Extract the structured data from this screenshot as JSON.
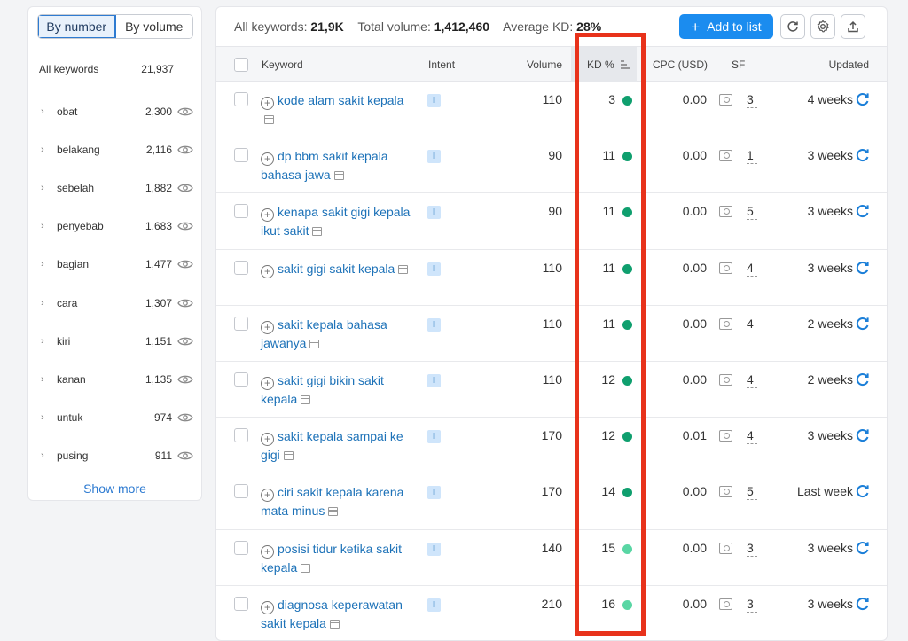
{
  "toggle": {
    "by_number": "By number",
    "by_volume": "By volume"
  },
  "groups_header": {
    "label": "All keywords",
    "count": "21,937"
  },
  "groups": [
    {
      "word": "obat",
      "count": "2,300"
    },
    {
      "word": "belakang",
      "count": "2,116"
    },
    {
      "word": "sebelah",
      "count": "1,882"
    },
    {
      "word": "penyebab",
      "count": "1,683"
    },
    {
      "word": "bagian",
      "count": "1,477"
    },
    {
      "word": "cara",
      "count": "1,307"
    },
    {
      "word": "kiri",
      "count": "1,151"
    },
    {
      "word": "kanan",
      "count": "1,135"
    },
    {
      "word": "untuk",
      "count": "974"
    },
    {
      "word": "pusing",
      "count": "911"
    }
  ],
  "show_more": "Show more",
  "summary": {
    "all_label": "All keywords:",
    "all_value": "21,9K",
    "volume_label": "Total volume:",
    "volume_value": "1,412,460",
    "kd_label": "Average KD:",
    "kd_value": "28%"
  },
  "add_to_list": "Add to list",
  "columns": {
    "keyword": "Keyword",
    "intent": "Intent",
    "volume": "Volume",
    "kd": "KD %",
    "cpc": "CPC (USD)",
    "sf": "SF",
    "updated": "Updated"
  },
  "colors": {
    "kd_dark": "#0f9f6e",
    "kd_light": "#59d6a4",
    "highlight": "#e8321b",
    "accent": "#1b8cef"
  },
  "rows": [
    {
      "keyword": "kode alam sakit kepala",
      "intent": "I",
      "volume": "110",
      "kd": "3",
      "kd_color": "#0f9f6e",
      "cpc": "0.00",
      "sf": "3",
      "updated": "4 weeks"
    },
    {
      "keyword": "dp bbm sakit kepala bahasa jawa",
      "intent": "I",
      "volume": "90",
      "kd": "11",
      "kd_color": "#0f9f6e",
      "cpc": "0.00",
      "sf": "1",
      "updated": "3 weeks"
    },
    {
      "keyword": "kenapa sakit gigi kepala ikut sakit",
      "intent": "I",
      "volume": "90",
      "kd": "11",
      "kd_color": "#0f9f6e",
      "cpc": "0.00",
      "sf": "5",
      "updated": "3 weeks"
    },
    {
      "keyword": "sakit gigi sakit kepala",
      "intent": "I",
      "volume": "110",
      "kd": "11",
      "kd_color": "#0f9f6e",
      "cpc": "0.00",
      "sf": "4",
      "updated": "3 weeks"
    },
    {
      "keyword": "sakit kepala bahasa jawanya",
      "intent": "I",
      "volume": "110",
      "kd": "11",
      "kd_color": "#0f9f6e",
      "cpc": "0.00",
      "sf": "4",
      "updated": "2 weeks"
    },
    {
      "keyword": "sakit gigi bikin sakit kepala",
      "intent": "I",
      "volume": "110",
      "kd": "12",
      "kd_color": "#0f9f6e",
      "cpc": "0.00",
      "sf": "4",
      "updated": "2 weeks"
    },
    {
      "keyword": "sakit kepala sampai ke gigi",
      "intent": "I",
      "volume": "170",
      "kd": "12",
      "kd_color": "#0f9f6e",
      "cpc": "0.01",
      "sf": "4",
      "updated": "3 weeks"
    },
    {
      "keyword": "ciri sakit kepala karena mata minus",
      "intent": "I",
      "volume": "170",
      "kd": "14",
      "kd_color": "#0f9f6e",
      "cpc": "0.00",
      "sf": "5",
      "updated": "Last week"
    },
    {
      "keyword": "posisi tidur ketika sakit kepala",
      "intent": "I",
      "volume": "140",
      "kd": "15",
      "kd_color": "#59d6a4",
      "cpc": "0.00",
      "sf": "3",
      "updated": "3 weeks"
    },
    {
      "keyword": "diagnosa keperawatan sakit kepala",
      "intent": "I",
      "volume": "210",
      "kd": "16",
      "kd_color": "#59d6a4",
      "cpc": "0.00",
      "sf": "3",
      "updated": "3 weeks"
    }
  ]
}
